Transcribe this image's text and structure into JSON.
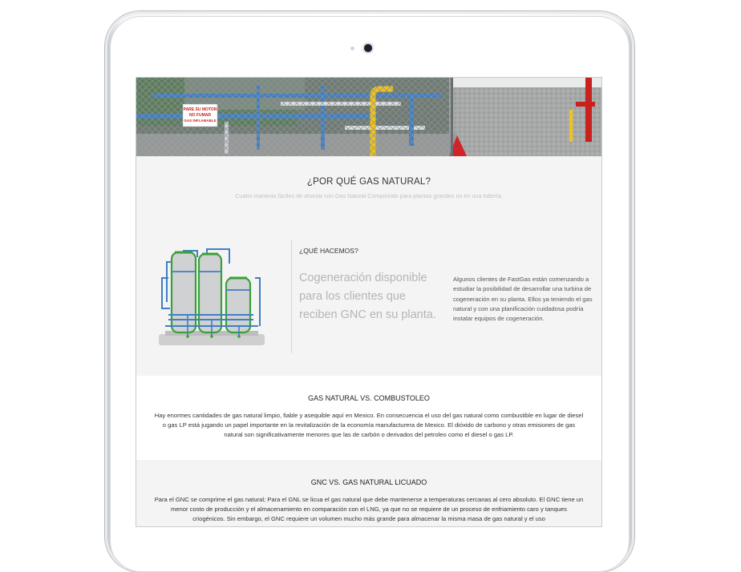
{
  "hero": {
    "sign_text": "PARE SU MOTOR NO FUMAR GAS INFLAMABLE"
  },
  "why": {
    "title": "¿POR QUÉ GAS NATURAL?",
    "subtitle": "Cuatro maneras fáciles de ahorrar con Gas Natural Comprimido para plantas grandes no en una tubería."
  },
  "slide": {
    "heading": "¿QUÉ HACEMOS?",
    "headline": "Cogeneración disponible para los clientes que reciben GNC en su planta.",
    "description": "Algunos clientes de FastGas están comenzando a estudiar la posibilidad de desarrollar una turbina de cogeneración en su planta. Ellos ya teniendo el gas natural y con una planificación cuidadosa podría instalar equipos de cogeneración."
  },
  "section_gas_vs_fuel": {
    "title": "GAS NATURAL VS. COMBUSTOLEO",
    "body": "Hay enormes cantidades de gas natural limpio, fiable y asequible aquí en Mexico. En consecuencia el uso del gas natural como combustible en lugar de diesel o gas LP está jugando un papel importante en la revitalización de la economía manufacturera de Mexico. El dióxido de carbono y otras emisiones de gas natural son significativamente menores que las de carbón o derivados del petroleo como el diesel o gas LP."
  },
  "section_gnc_vs_lng": {
    "title": "GNC VS. GAS NATURAL LICUADO",
    "body": "Para el GNC se comprime el gas natural; Para el GNL se licua el gas natural que debe mantenerse a temperaturas cercanas al cero absoluto. El GNC tiene un menor costo de producción y el almacenamiento en comparación con el LNG, ya que no se requiere de un proceso de enfriamiento caro y tanques criogénicos. Sin embargo, el GNC requiere un volumen mucho más grande para almacenar la misma masa de gas natural y el uso"
  },
  "colors": {
    "accent_blue": "#2d6bb0",
    "tank_green": "#3aa03a",
    "pipe_blue": "#3f7fc4",
    "pipe_yellow": "#f0c21a",
    "pipe_red": "#c8211e"
  }
}
